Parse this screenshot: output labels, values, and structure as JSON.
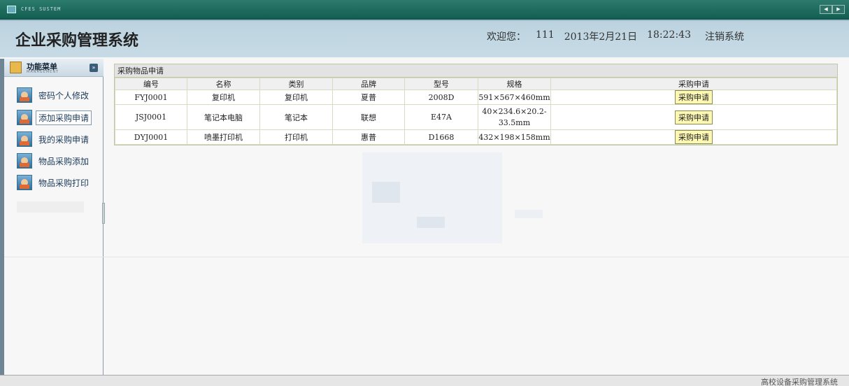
{
  "app": {
    "brand": "CFES SUSTEM",
    "title": "企业采购管理系统"
  },
  "header": {
    "welcome_label": "欢迎您：",
    "user": "111",
    "date": "2013年2月21日",
    "time": "18:22:43",
    "logout": "注销系统"
  },
  "menu": {
    "title": "功能菜单",
    "subtitle": "MANAGEMENT",
    "items": [
      {
        "label": "密码个人修改"
      },
      {
        "label": "添加采购申请"
      },
      {
        "label": "我的采购申请"
      },
      {
        "label": "物品采购添加"
      },
      {
        "label": "物品采购打印"
      }
    ]
  },
  "grid": {
    "title": "采购物品申请",
    "columns": [
      "编号",
      "名称",
      "类别",
      "品牌",
      "型号",
      "规格",
      "采购申请"
    ],
    "rows": [
      {
        "id": "FYJ0001",
        "name": "复印机",
        "category": "复印机",
        "brand": "夏普",
        "model": "2008D",
        "spec": "591×567×460mm",
        "action": "采购申请"
      },
      {
        "id": "JSJ0001",
        "name": "笔记本电脑",
        "category": "笔记本",
        "brand": "联想",
        "model": "E47A",
        "spec": "40×234.6×20.2-33.5mm",
        "action": "采购申请"
      },
      {
        "id": "DYJ0001",
        "name": "喷墨打印机",
        "category": "打印机",
        "brand": "惠普",
        "model": "D1668",
        "spec": "432×198×158mm",
        "action": "采购申请"
      }
    ]
  },
  "footer": {
    "text": "高校设备采购管理系统"
  }
}
